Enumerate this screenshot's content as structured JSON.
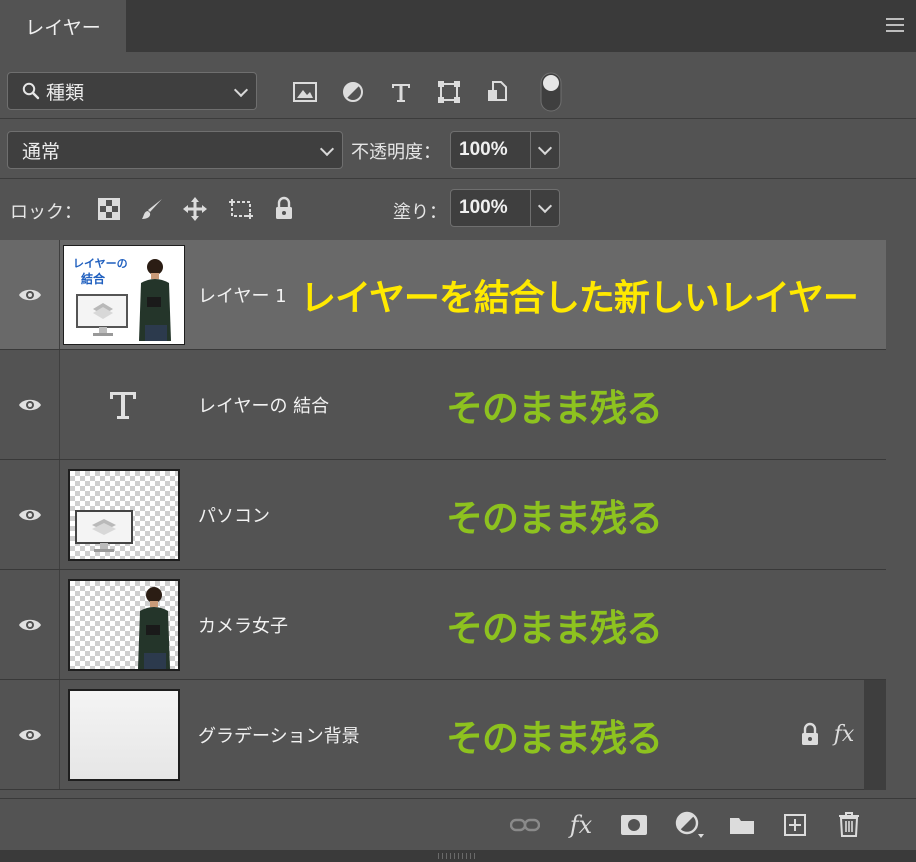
{
  "panel": {
    "tab_label": "レイヤー"
  },
  "filter": {
    "kind_label": "種類",
    "icons": [
      "image-filter-icon",
      "adjustment-filter-icon",
      "type-filter-icon",
      "shape-filter-icon",
      "smart-object-filter-icon",
      "filter-toggle-icon"
    ]
  },
  "blend": {
    "mode": "通常",
    "opacity_label": "不透明度：",
    "opacity_value": "100%"
  },
  "lock": {
    "label": "ロック：",
    "icons": [
      "lock-transparent-pixels-icon",
      "lock-image-pixels-icon",
      "lock-position-icon",
      "lock-artboard-icon",
      "lock-all-icon"
    ],
    "fill_label": "塗り：",
    "fill_value": "100%"
  },
  "thumb_text": {
    "line1": "レイヤーの",
    "line2": "結合"
  },
  "layers": [
    {
      "name": "レイヤー 1",
      "annotation": "レイヤーを結合した新しいレイヤー",
      "selected": true,
      "visible": true
    },
    {
      "name": "レイヤーの 結合",
      "annotation": "そのまま残る",
      "type_layer": true,
      "visible": true
    },
    {
      "name": "パソコン",
      "annotation": "そのまま残る",
      "visible": true
    },
    {
      "name": "カメラ女子",
      "annotation": "そのまま残る",
      "visible": true
    },
    {
      "name": "グラデーション背景",
      "annotation": "そのまま残る",
      "locked": true,
      "effects_label": "fx",
      "visible": true
    }
  ],
  "bottom": {
    "icons": [
      "link-layers-icon",
      "add-layer-style-icon",
      "add-mask-icon",
      "new-adjustment-layer-icon",
      "new-group-icon",
      "new-layer-icon",
      "delete-layer-icon"
    ],
    "fx_label": "fx"
  },
  "colors": {
    "annotation_yellow": "#ffe900",
    "annotation_green": "#8dc21f",
    "panel_bg": "#535353",
    "selected_row": "#696969"
  }
}
